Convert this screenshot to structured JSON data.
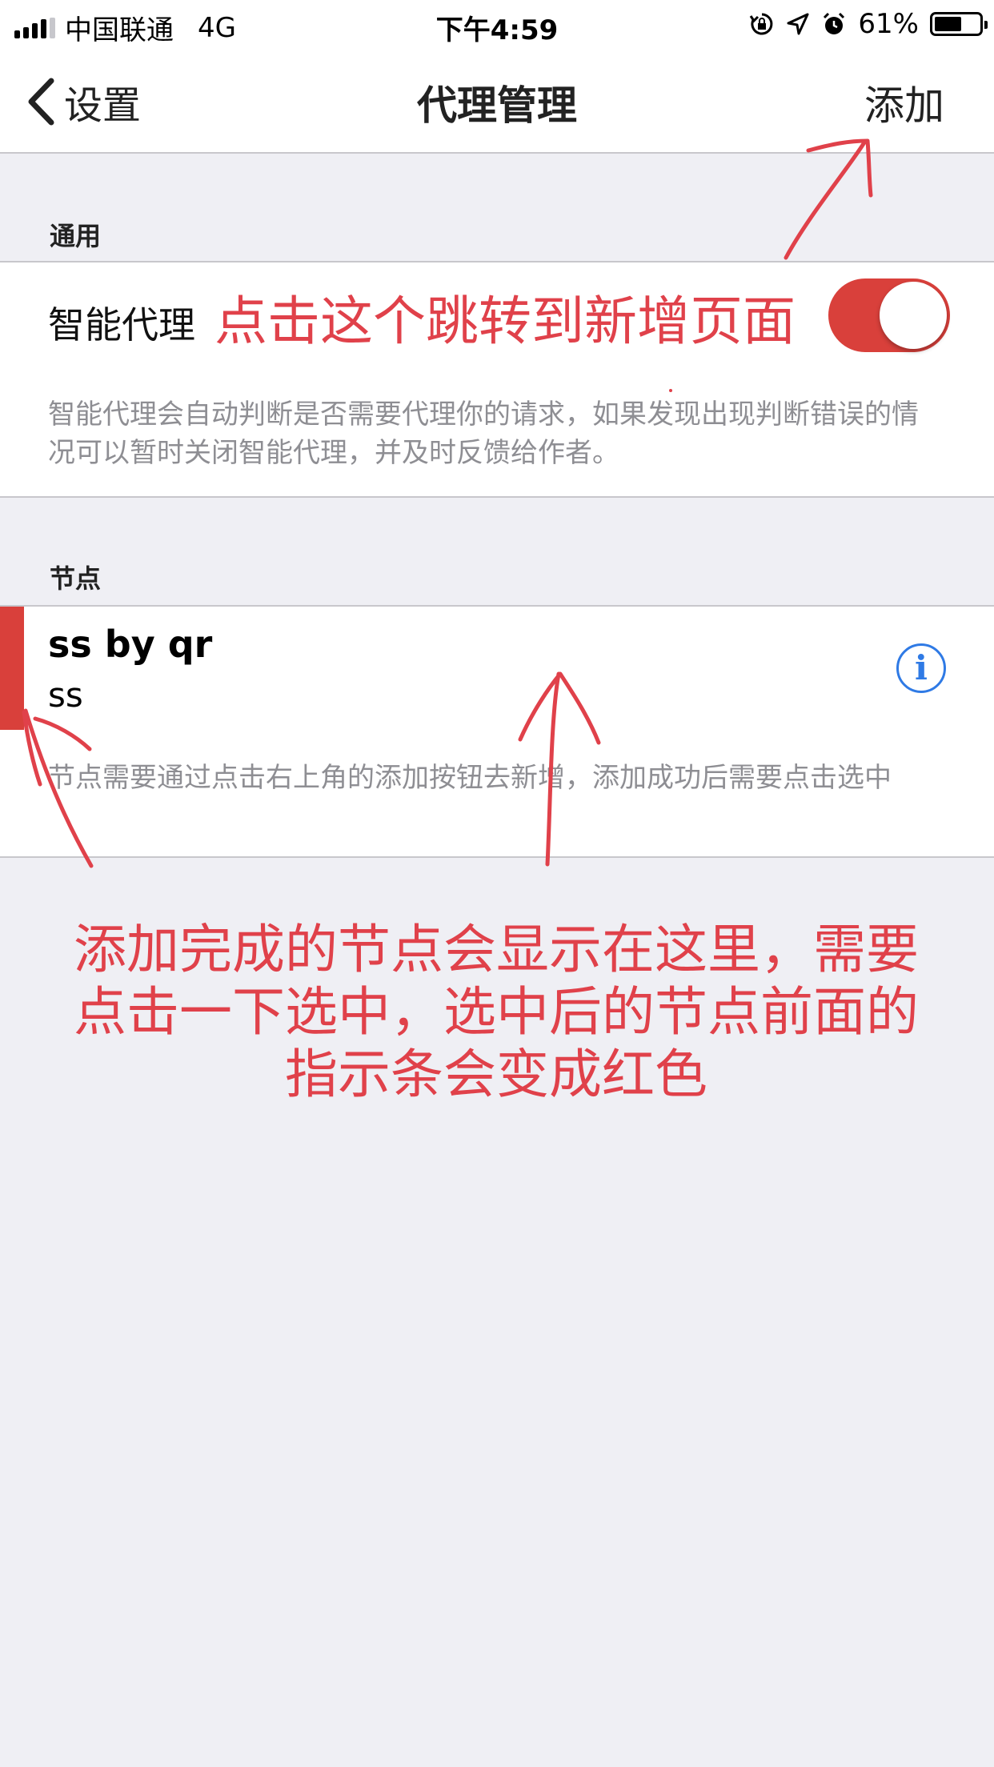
{
  "status_bar": {
    "carrier": "中国联通",
    "network": "4G",
    "time": "下午4:59",
    "battery_percent": "61%",
    "battery_level": 0.61
  },
  "nav": {
    "back_label": "设置",
    "title": "代理管理",
    "add_label": "添加"
  },
  "general": {
    "header": "通用",
    "smart_proxy_label": "智能代理",
    "smart_proxy_on": true,
    "footer": "智能代理会自动判断是否需要代理你的请求，如果发现出现判断错误的情况可以暂时关闭智能代理，并及时反馈给作者。"
  },
  "nodes": {
    "header": "节点",
    "items": [
      {
        "name": "ss by qr",
        "type": "ss",
        "selected": true
      }
    ],
    "footer": "节点需要通过点击右上角的添加按钮去新增，添加成功后需要点击选中"
  },
  "annotations": {
    "add_hint": "点击这个跳转到新增页面",
    "node_hint_line1": "添加完成的节点会显示在这里，需要",
    "node_hint_line2": "点击一下选中，选中后的节点前面的",
    "node_hint_line3": "指示条会变成红色"
  },
  "colors": {
    "accent_red": "#d9403b",
    "info_blue": "#2f7ae5",
    "annotation_red": "#e0414a"
  }
}
